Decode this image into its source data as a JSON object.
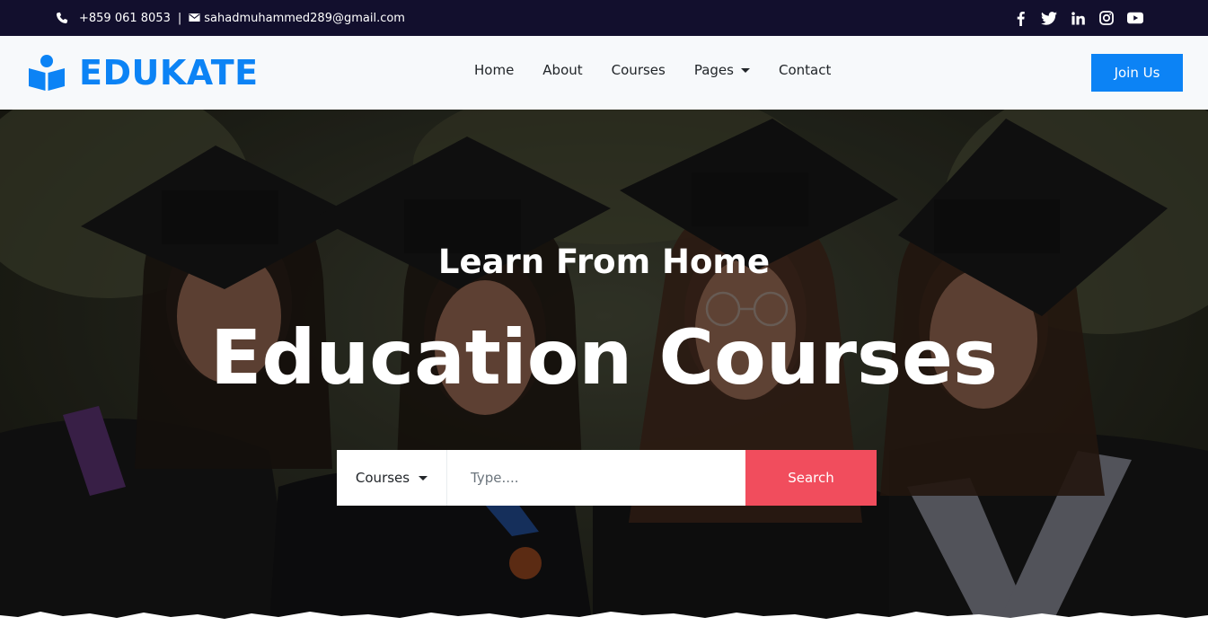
{
  "topbar": {
    "phone": "+859 061 8053",
    "separator": "|",
    "email": "sahadmuhammed289@gmail.com",
    "social_icons": [
      "facebook-icon",
      "twitter-icon",
      "linkedin-icon",
      "instagram-icon",
      "youtube-icon"
    ]
  },
  "navbar": {
    "brand": "EDUKATE",
    "links": {
      "home": "Home",
      "about": "About",
      "courses": "Courses",
      "pages": "Pages",
      "contact": "Contact"
    },
    "join_label": "Join Us"
  },
  "hero": {
    "subtitle": "Learn From Home",
    "title": "Education Courses",
    "search": {
      "category": "Courses",
      "placeholder": "Type....",
      "button": "Search"
    }
  },
  "colors": {
    "topbar": "#120f2d",
    "brand": "#0c83f5",
    "search_button": "#f14d5d"
  }
}
